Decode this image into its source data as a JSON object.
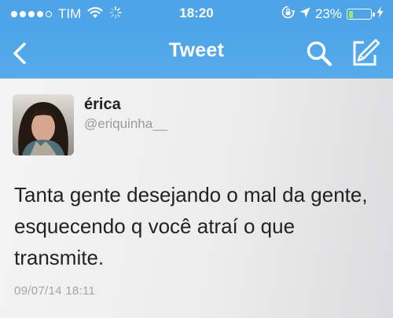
{
  "status_bar": {
    "carrier": "TIM",
    "time": "18:20",
    "battery": "23%",
    "battery_level": 0.23,
    "signal_bars": 4,
    "icons": [
      "signal-dots-icon",
      "wifi-icon",
      "activity-spinner-icon",
      "rotation-lock-icon",
      "location-arrow-icon",
      "battery-icon",
      "charging-bolt-icon"
    ]
  },
  "navbar": {
    "title": "Tweet",
    "icons": [
      "back-chevron-icon",
      "search-icon",
      "compose-icon"
    ]
  },
  "tweet": {
    "name": "érica",
    "handle": "@eriquinha__",
    "text": "Tanta gente desejando o mal da gente, esquecendo q você atraí o que transmite.",
    "timestamp": "09/07/14 18:11"
  },
  "colors": {
    "bar_blue": "#4fa4e8",
    "tweet_text": "#222222",
    "secondary_text": "#9a9a9e",
    "battery_fill": "#9be870"
  }
}
